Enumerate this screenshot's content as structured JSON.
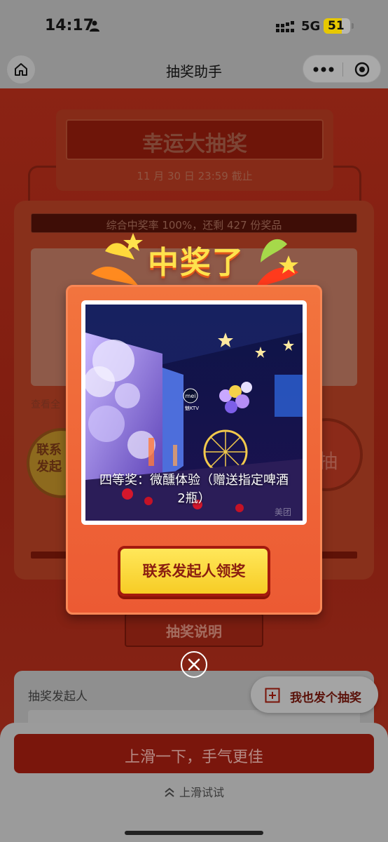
{
  "status_bar": {
    "time": "14:17",
    "network": "5G",
    "battery": "51"
  },
  "nav": {
    "title": "抽奖助手"
  },
  "machine": {
    "title": "幸运大抽奖",
    "deadline": "11 月 30 日 23:59 截止",
    "rate_text": "综合中奖率 100%，还剩 427 份奖品",
    "view_all": "查看全",
    "left_button": "联系\n发起",
    "right_button": "抽",
    "rules_tab": "抽奖说明"
  },
  "initiator": {
    "label": "抽奖发起人"
  },
  "my_lottery_button": "我也发个抽奖",
  "bottom": {
    "swipe_button": "上滑一下，手气更佳",
    "swipe_hint": "上滑试试"
  },
  "modal": {
    "title": "中奖了",
    "prize_name": "四等奖：微醺体验（赠送指定啤酒2瓶）",
    "claim_button": "联系发起人领奖",
    "photo_logo": "mei",
    "photo_logo_sub": "魅KTV",
    "photo_watermark": "美团"
  },
  "colors": {
    "accent": "#ec5a33",
    "title_yellow": "#ffe24d",
    "button_yellow": "#f7cc25",
    "dark_red": "#8a1d10"
  }
}
